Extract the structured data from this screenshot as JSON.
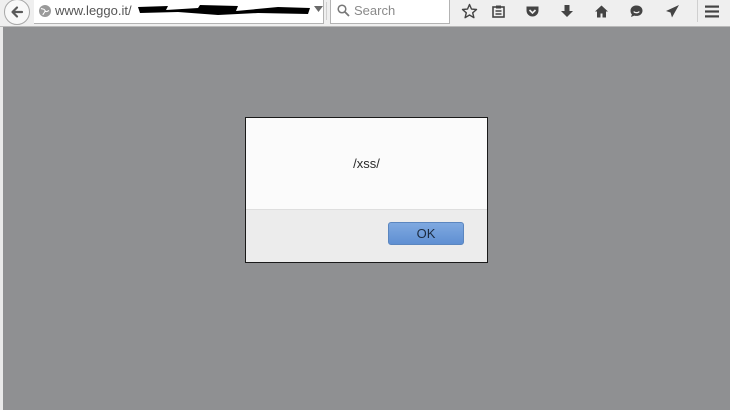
{
  "browser": {
    "url_host": "www.leggo.it",
    "url_tail": "/",
    "search_placeholder": "Search",
    "icons": [
      "back-arrow-icon",
      "globe-icon",
      "dropdown-icon",
      "close-icon",
      "search-icon",
      "bookmark-star-icon",
      "reading-list-icon",
      "pocket-icon",
      "download-icon",
      "home-icon",
      "chat-icon",
      "share-icon",
      "hamburger-menu-icon"
    ]
  },
  "dialog": {
    "message": "/xss/",
    "ok_label": "OK"
  }
}
